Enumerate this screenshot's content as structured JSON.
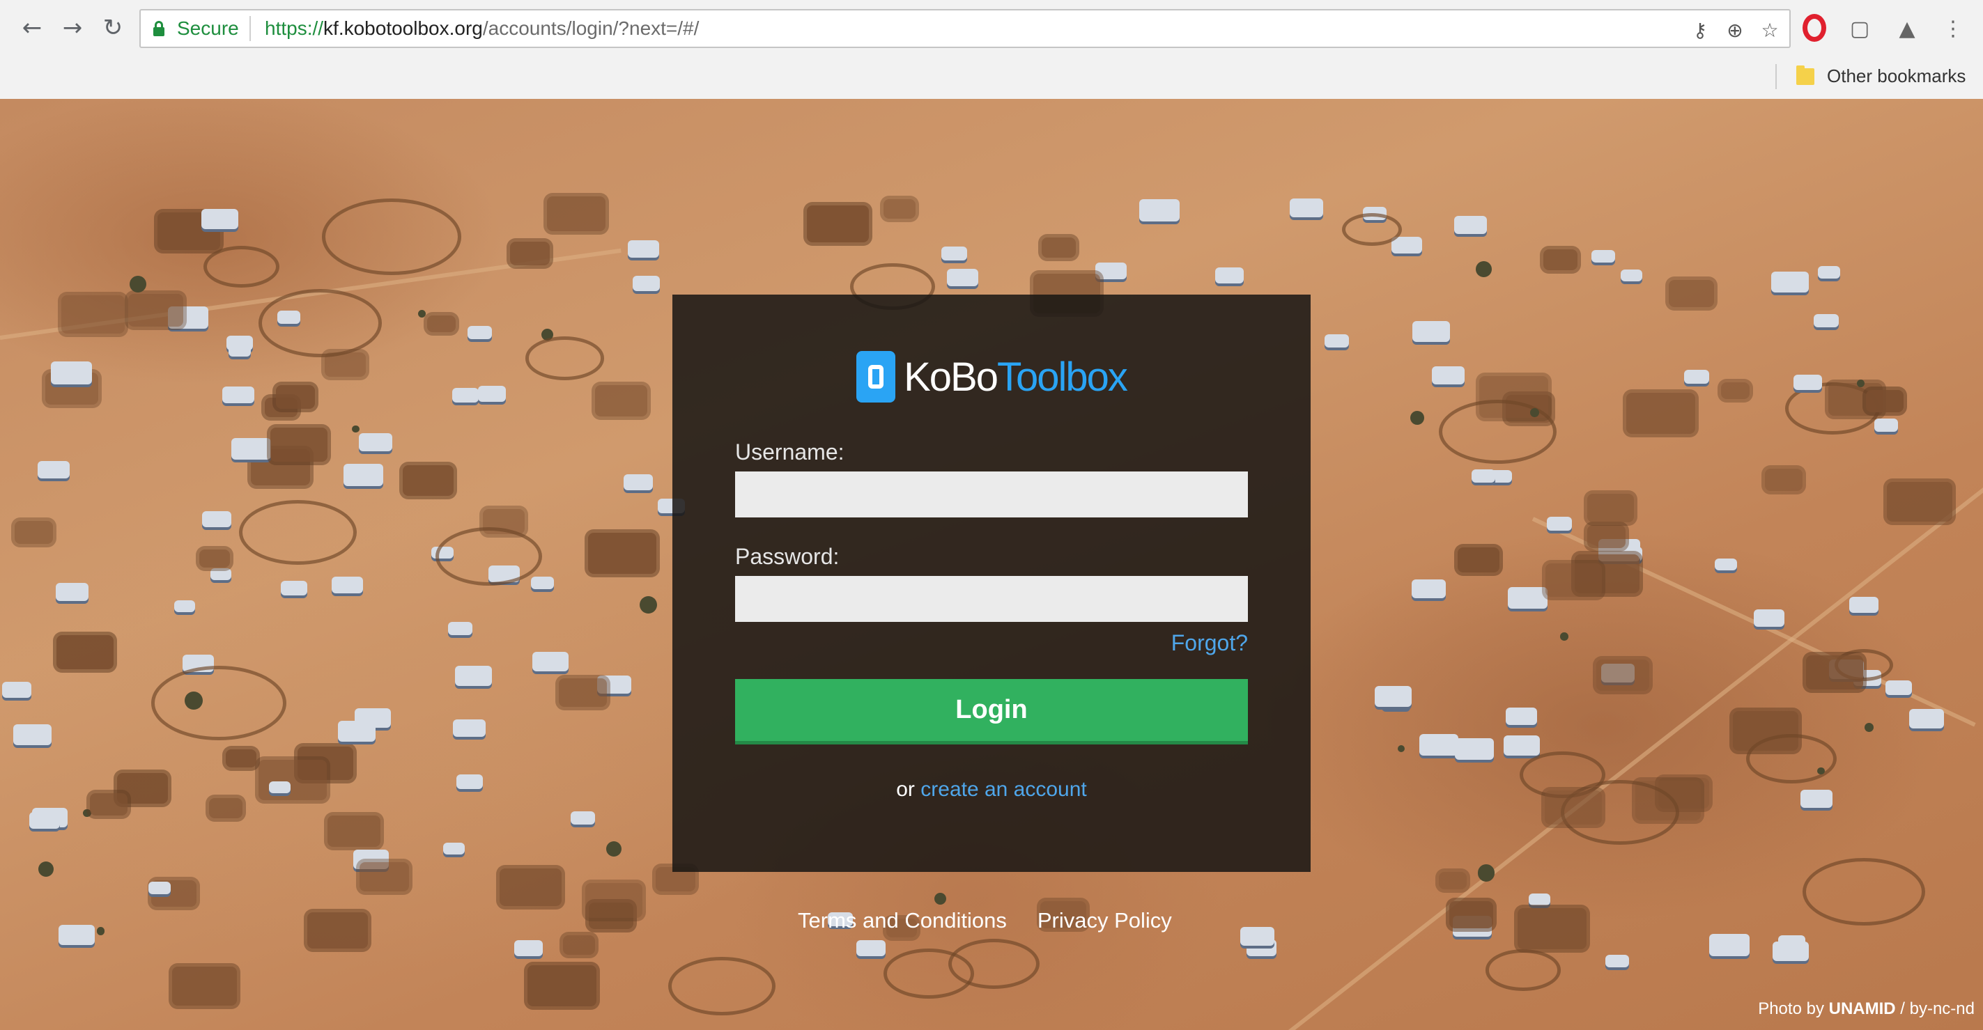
{
  "browser": {
    "back_icon": "arrow-left-icon",
    "forward_icon": "arrow-right-icon",
    "reload_icon": "reload-icon",
    "security_label": "Secure",
    "url_scheme": "https://",
    "url_host": "kf.kobotoolbox.org",
    "url_path": "/accounts/login/?next=/#/",
    "bookmarks": {
      "other_label": "Other bookmarks"
    }
  },
  "login": {
    "logo_ko": "KoBo",
    "logo_toolbox": "Toolbox",
    "username_label": "Username:",
    "username_value": "",
    "password_label": "Password:",
    "password_value": "",
    "forgot_label": "Forgot?",
    "login_button": "Login",
    "or_text": "or",
    "create_account": "create an account"
  },
  "footer": {
    "terms": "Terms and Conditions",
    "privacy": "Privacy Policy"
  },
  "photo_credit": {
    "prefix": "Photo by",
    "org": "UNAMID",
    "license": "/ by-nc-nd"
  },
  "colors": {
    "login_green": "#31b15f",
    "link_blue": "#4fa6ea",
    "brand_blue": "#2aa4f4",
    "secure_green": "#1e8e3e"
  }
}
